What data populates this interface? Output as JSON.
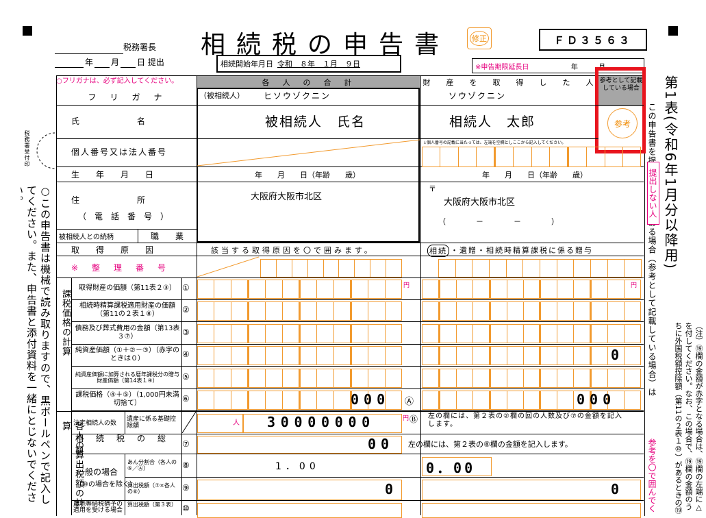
{
  "header": {
    "title": "相続税の申告書",
    "correction_badge": "修正",
    "form_code": "ＦＤ３５６３",
    "tax_office_suffix": "税務署長",
    "submit_line_year": "年",
    "submit_line_month": "月",
    "submit_line_day": "日 提出",
    "start_date_label": "相続開始年月日",
    "start_date_value": "令和　８年　１月　９日",
    "furigana_note": "○フリガナは、必ず記入してください。",
    "deadline_label": "※申告期限延長日",
    "deadline_year": "年",
    "deadline_month": "月",
    "deadline_day": "日"
  },
  "columns": {
    "aggregate": "各　人　の　合　計",
    "acquirer": "財　産　を　取　得　し　た　人",
    "reference_note": "参考として記載している場合",
    "reference_badge": "参考"
  },
  "side_right": {
    "table_no": "第1表(令和6年1月分以降用)",
    "note1": "この申告書を提出しない人である場合（参考として記載している場合）は",
    "highlight": "提出しない人",
    "note2": "参考を〇で囲んでください。",
    "note3": "（注）⑲欄の金額が赤字となる場合は、⑲欄の左端に△を付してください。なお、この場合で、⑲欄の金額のうちに外国税額控除額（第11の２表１⑩）があるときの⑲欄の金額については、"
  },
  "side_left": {
    "receipt": "税務署受付印",
    "instructions": "○この申告書は機械で読み取りますので、黒ボールペンで記入してください。また、申告書と添付資料を一緒にとじないでください。"
  },
  "rows": {
    "furigana": "フ　リ　ガ　ナ",
    "deceased_tag": "（被相続人）",
    "deceased_kana": "ヒソウゾクニン",
    "heir_kana": "ソウゾクニン",
    "name_label": "氏　　　　　　　名",
    "deceased_name": "被相続人　氏名",
    "heir_name": "相続人　太郎",
    "mynumber_label": "個人番号又は法人番号",
    "mynumber_note": "↓個人番号の記載に当たっては、左端を空欄としここから記入してください。",
    "birth_label": "生　　年　　月　　日",
    "birth_fields": "年　　月　　日（年齢　　歳）",
    "address_label": "住　　　　　　　所",
    "phone_label": "（　電　話　番　号　）",
    "deceased_address": "大阪府大阪市北区",
    "postal_mark": "〒",
    "heir_address": "大阪府大阪市北区",
    "phone_template": "（　　　　－　　　　－　　　　）",
    "relation_label": "被相続人との続柄",
    "job_label": "職　　業",
    "cause_label": "取　　得　　原　　因",
    "cause_agg": "該当する取得原因を〇で囲みます。",
    "cause_heir_1": "相続",
    "cause_heir_2": "・遺贈・相続時精算課税に係る贈与",
    "ref_no_label": "※　整　理　番　号"
  },
  "section_kazei": {
    "group_label": "課税価格の計算",
    "row1_label": "取得財産の価額（第11表２③）",
    "row1_no": "①",
    "row2_label": "相続時精算課税適用財産の価額（第11の２表１⑧）",
    "row2_no": "②",
    "row3_label": "債務及び葬式費用の金額（第13表３⑦）",
    "row3_no": "③",
    "row4_label": "純資産価額（①＋②－③）（赤字のときは０）",
    "row4_no": "④",
    "row5_label": "純資産価額に加算される暦年課税分の贈与財産価額（第14表１④）",
    "row5_no": "⑤",
    "row6_label": "課税価格（④＋⑤）（1,000円未満切捨て）",
    "row6_no": "⑥",
    "yen": "円",
    "row4_heir_value": "0",
    "row6_agg_value": "000",
    "row6_heir_value": "000",
    "mark_a": "Ⓐ"
  },
  "section_tax": {
    "group_label": "各人の算出税額の計算",
    "heirs_count_label": "法定相続人の数",
    "basic_deduction_label": "遺産に係る基礎控除額",
    "person_unit": "人",
    "basic_deduction_value": "30000000",
    "mark_b": "Ⓑ",
    "basic_note": "左の欄には、第２表の②欄の回の人数及び⑦の金額を記入します。",
    "row7_label": "相　続　税　の　総　額",
    "row7_no": "⑦",
    "row7_value": "00",
    "row7_note": "左の欄には、第２表の⑧欄の金額を記入します。",
    "general_label": "一般の場合",
    "general_sub": "（⑩の場合を除く）",
    "row8_sub": "あん分割合（各人の⑥／Ⓐ）",
    "row8_no": "⑧",
    "row8_agg_value": "1．00",
    "row8_heir_value": "0．00",
    "row9_sub": "算出税額（⑦×各人の⑧）",
    "row9_no": "⑨",
    "row9_agg_value": "0",
    "row9_heir_value": "0",
    "row10_label": "農地等納税猶予の適用を受ける場合",
    "row10_sub": "算出税額（第３表）",
    "row10_no": "⑩"
  }
}
